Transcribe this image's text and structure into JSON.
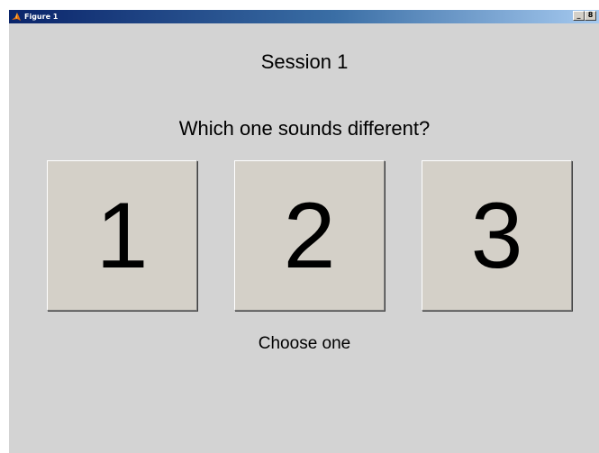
{
  "window": {
    "title": "Figure 1",
    "controls": {
      "minimize": "_",
      "maximize": "8"
    }
  },
  "main": {
    "session_label": "Session 1",
    "question": "Which one sounds different?",
    "choices": [
      "1",
      "2",
      "3"
    ],
    "instruction": "Choose one"
  },
  "colors": {
    "background": "#d3d3d3",
    "button_face": "#d4d0c8",
    "titlebar_start": "#0a246a",
    "titlebar_end": "#a6caf0"
  }
}
